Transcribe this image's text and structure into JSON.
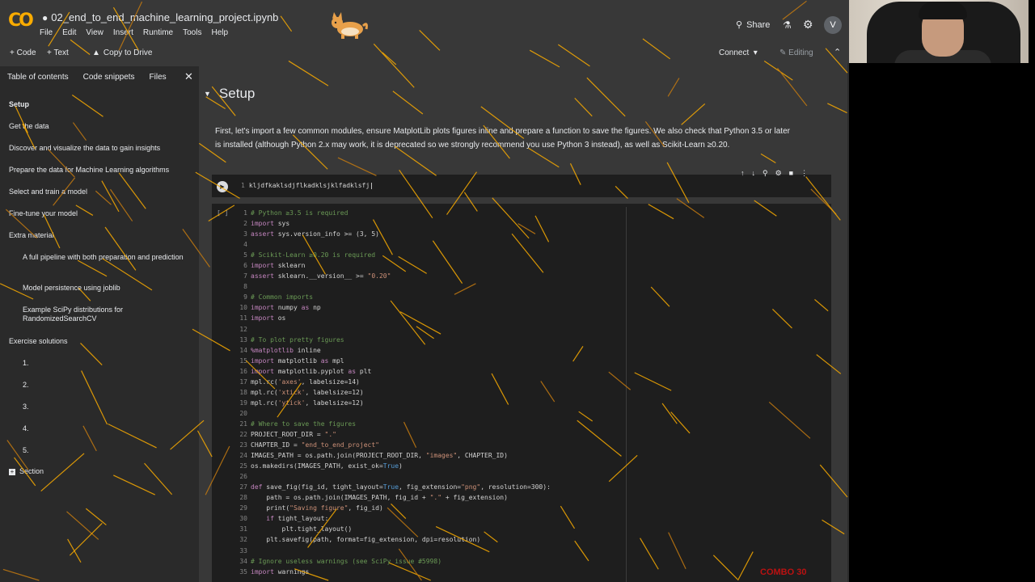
{
  "header": {
    "logo": "CO",
    "notebook_title": "02_end_to_end_machine_learning_project.ipynb",
    "menu": [
      "File",
      "Edit",
      "View",
      "Insert",
      "Runtime",
      "Tools",
      "Help"
    ],
    "share_label": "Share",
    "avatar_initial": "V"
  },
  "toolbar": {
    "code_label": "+ Code",
    "text_label": "+ Text",
    "copy_drive_label": "Copy to Drive",
    "connect_label": "Connect",
    "editing_label": "Editing"
  },
  "sidebar": {
    "tabs": [
      "Table of contents",
      "Code snippets",
      "Files"
    ],
    "toc": [
      {
        "label": "Setup",
        "active": true
      },
      {
        "label": "Get the data"
      },
      {
        "label": "Discover and visualize the data to gain insights"
      },
      {
        "label": "Prepare the data for Machine Learning algorithms"
      },
      {
        "label": "Select and train a model"
      },
      {
        "label": "Fine-tune your model"
      },
      {
        "label": "Extra material"
      },
      {
        "label": "A full pipeline with both preparation and prediction",
        "indent": true
      },
      {
        "label": "Model persistence using joblib",
        "indent": true
      },
      {
        "label": "Example SciPy distributions for RandomizedSearchCV",
        "indent": true
      },
      {
        "label": "Exercise solutions"
      },
      {
        "label": "1.",
        "indent": true
      },
      {
        "label": "2.",
        "indent": true
      },
      {
        "label": "3.",
        "indent": true
      },
      {
        "label": "4.",
        "indent": true
      },
      {
        "label": "5.",
        "indent": true
      }
    ],
    "add_section_label": "Section"
  },
  "main": {
    "section_title": "Setup",
    "intro_text": "First, let's import a few common modules, ensure MatplotLib plots figures inline and prepare a function to save the figures. We also check that Python 3.5 or later is installed (although Python 2.x may work, it is deprecated so we strongly recommend you use Python 3 instead), as well as Scikit-Learn ≥0.20.",
    "cell1": {
      "line_no": "1",
      "code": "kljdfkaklsdjflkadklsjklfadklsfj"
    },
    "cell2_bracket": "[ ]",
    "code_lines": [
      [
        [
          "cm",
          "# Python ≥3.5 is required"
        ]
      ],
      [
        [
          "kw",
          "import"
        ],
        [
          "tx",
          " sys"
        ]
      ],
      [
        [
          "kw",
          "assert"
        ],
        [
          "tx",
          " sys.version_info >= (3, 5)"
        ]
      ],
      [],
      [
        [
          "cm",
          "# Scikit-Learn ≥0.20 is required"
        ]
      ],
      [
        [
          "kw",
          "import"
        ],
        [
          "tx",
          " sklearn"
        ]
      ],
      [
        [
          "kw",
          "assert"
        ],
        [
          "tx",
          " sklearn.__version__ >= "
        ],
        [
          "st",
          "\"0.20\""
        ]
      ],
      [],
      [
        [
          "cm",
          "# Common imports"
        ]
      ],
      [
        [
          "kw",
          "import"
        ],
        [
          "tx",
          " numpy "
        ],
        [
          "kw",
          "as"
        ],
        [
          "tx",
          " np"
        ]
      ],
      [
        [
          "kw",
          "import"
        ],
        [
          "tx",
          " os"
        ]
      ],
      [],
      [
        [
          "cm",
          "# To plot pretty figures"
        ]
      ],
      [
        [
          "kw",
          "%matplotlib"
        ],
        [
          "tx",
          " inline"
        ]
      ],
      [
        [
          "kw",
          "import"
        ],
        [
          "tx",
          " matplotlib "
        ],
        [
          "kw",
          "as"
        ],
        [
          "tx",
          " mpl"
        ]
      ],
      [
        [
          "kw",
          "import"
        ],
        [
          "tx",
          " matplotlib.pyplot "
        ],
        [
          "kw",
          "as"
        ],
        [
          "tx",
          " plt"
        ]
      ],
      [
        [
          "tx",
          "mpl.rc("
        ],
        [
          "st",
          "'axes'"
        ],
        [
          "tx",
          ", labelsize=14)"
        ]
      ],
      [
        [
          "tx",
          "mpl.rc("
        ],
        [
          "st",
          "'xtick'"
        ],
        [
          "tx",
          ", labelsize=12)"
        ]
      ],
      [
        [
          "tx",
          "mpl.rc("
        ],
        [
          "st",
          "'ytick'"
        ],
        [
          "tx",
          ", labelsize=12)"
        ]
      ],
      [],
      [
        [
          "cm",
          "# Where to save the figures"
        ]
      ],
      [
        [
          "tx",
          "PROJECT_ROOT_DIR = "
        ],
        [
          "st",
          "\".\""
        ]
      ],
      [
        [
          "tx",
          "CHAPTER_ID = "
        ],
        [
          "st",
          "\"end_to_end_project\""
        ]
      ],
      [
        [
          "tx",
          "IMAGES_PATH = os.path.join(PROJECT_ROOT_DIR, "
        ],
        [
          "st",
          "\"images\""
        ],
        [
          "tx",
          ", CHAPTER_ID)"
        ]
      ],
      [
        [
          "tx",
          "os.makedirs(IMAGES_PATH, exist_ok="
        ],
        [
          "bl",
          "True"
        ],
        [
          "tx",
          ")"
        ]
      ],
      [],
      [
        [
          "kw",
          "def"
        ],
        [
          "tx",
          " save_fig(fig_id, tight_layout="
        ],
        [
          "bl",
          "True"
        ],
        [
          "tx",
          ", fig_extension="
        ],
        [
          "st",
          "\"png\""
        ],
        [
          "tx",
          ", resolution=300):"
        ]
      ],
      [
        [
          "tx",
          "    path = os.path.join(IMAGES_PATH, fig_id + "
        ],
        [
          "st",
          "\".\""
        ],
        [
          "tx",
          " + fig_extension)"
        ]
      ],
      [
        [
          "tx",
          "    print("
        ],
        [
          "st",
          "\"Saving figure\""
        ],
        [
          "tx",
          ", fig_id)"
        ]
      ],
      [
        [
          "tx",
          "    "
        ],
        [
          "kw",
          "if"
        ],
        [
          "tx",
          " tight_layout:"
        ]
      ],
      [
        [
          "tx",
          "        plt.tight_layout()"
        ]
      ],
      [
        [
          "tx",
          "    plt.savefig(path, format=fig_extension, dpi=resolution)"
        ]
      ],
      [],
      [
        [
          "cm",
          "# Ignore useless warnings (see SciPy issue #5998)"
        ]
      ],
      [
        [
          "kw",
          "import"
        ],
        [
          "tx",
          " warnings"
        ]
      ]
    ]
  },
  "watermark": "COMBO 30",
  "colors": {
    "accent": "#f9ab00",
    "background": "#383838",
    "code_bg": "#1e1e1e",
    "sidebar_bg": "#2a2a2a"
  }
}
